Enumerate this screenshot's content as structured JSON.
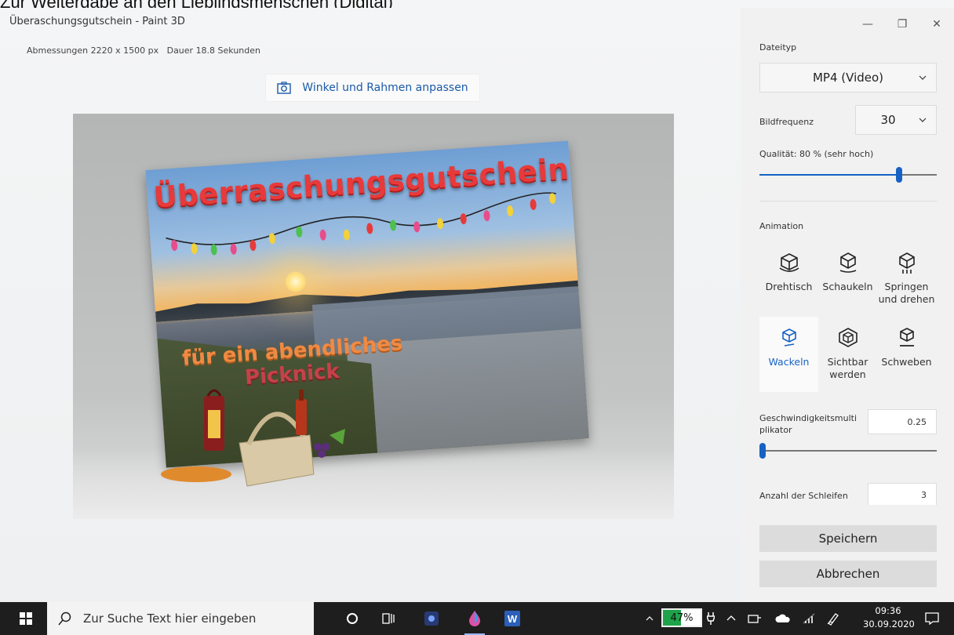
{
  "page_caption": "Zur Weitergabe an den Lieblingsmenschen (Digital)",
  "window": {
    "title": "Überaschungsgutschein - Paint 3D",
    "controls": {
      "minimize": "—",
      "maximize": "❐",
      "close": "✕"
    }
  },
  "info": {
    "dimensions": "Abmessungen 2220 x 1500 px",
    "duration": "Dauer 18.8 Sekunden"
  },
  "frame_button": {
    "label": "Winkel und Rahmen anpassen"
  },
  "card": {
    "title": "Überraschungsgutschein",
    "line1": "für ein abendliches",
    "line2": "Picknick"
  },
  "panel": {
    "filetype_label": "Dateityp",
    "filetype_value": "MP4 (Video)",
    "framerate_label": "Bildfrequenz",
    "framerate_value": "30",
    "quality_label": "Qualität: 80 % (sehr hoch)",
    "quality_value": 0.8,
    "animation_label": "Animation",
    "animations": [
      {
        "label": "Drehtisch",
        "icon": "turntable-icon"
      },
      {
        "label": "Schaukeln",
        "icon": "rock-icon"
      },
      {
        "label": "Springen und drehen",
        "icon": "jump-spin-icon"
      },
      {
        "label": "Wackeln",
        "icon": "wobble-icon"
      },
      {
        "label": "Sichtbar werden",
        "icon": "appear-icon"
      },
      {
        "label": "Schweben",
        "icon": "float-icon"
      }
    ],
    "selected_animation": "Wackeln",
    "speed_label": "Geschwindigkeitsmulti plikator",
    "speed_value": "0.25",
    "speed_slider_value": 0.0,
    "loops_label": "Anzahl der Schleifen",
    "loops_value": "3",
    "save_label": "Speichern",
    "cancel_label": "Abbrechen"
  },
  "taskbar": {
    "search_placeholder": "Zur Suche Text hier eingeben",
    "battery": "47%",
    "battery_level": 0.47,
    "time": "09:36",
    "date": "30.09.2020"
  },
  "colors": {
    "accent": "#1662c4",
    "title_red": "#e83a3a",
    "subtitle_orange": "#f08a42",
    "taskbar": "#1e1e1e",
    "battery_green": "#1fa34a"
  }
}
